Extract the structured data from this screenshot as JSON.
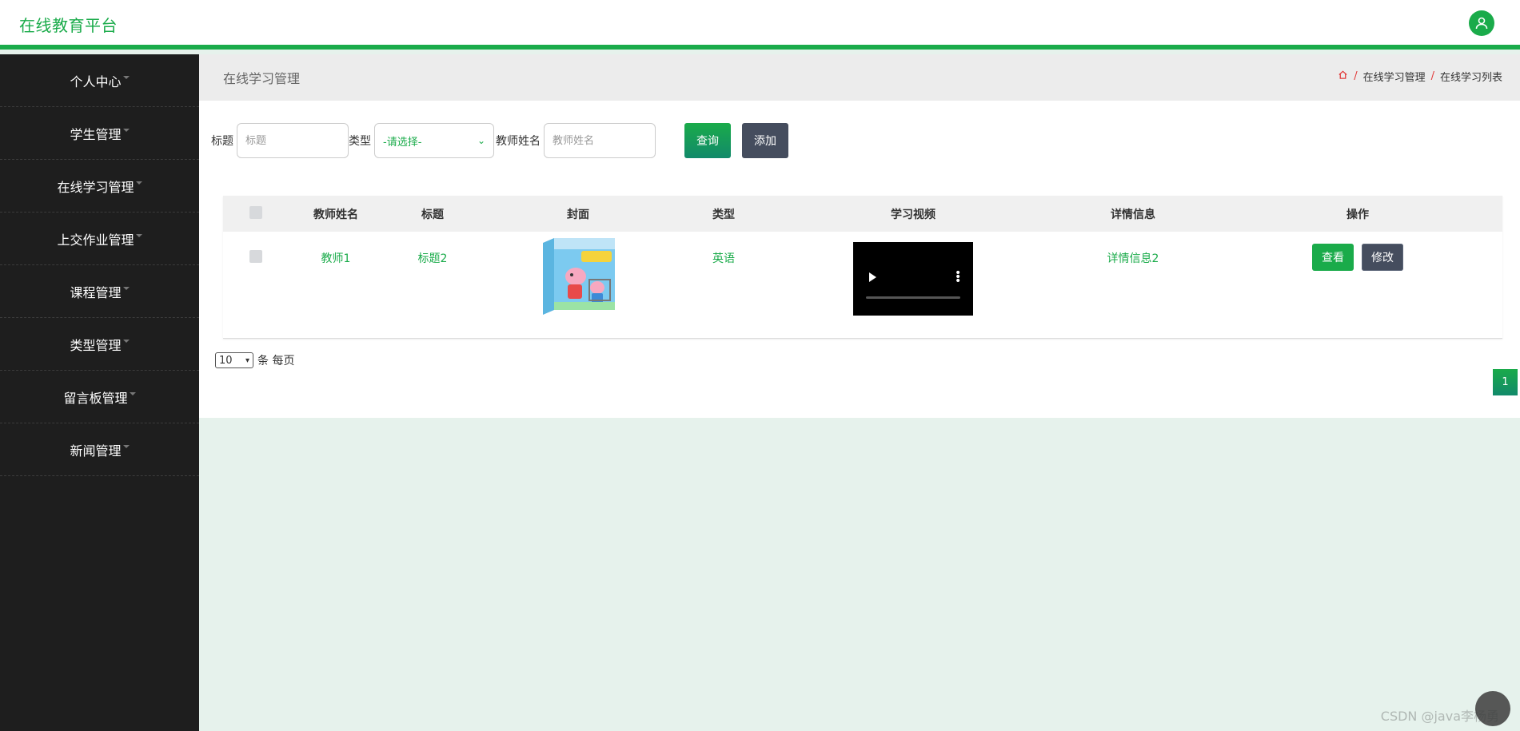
{
  "header": {
    "brand": "在线教育平台"
  },
  "sidebar": {
    "items": [
      {
        "label": "个人中心"
      },
      {
        "label": "学生管理"
      },
      {
        "label": "在线学习管理"
      },
      {
        "label": "上交作业管理"
      },
      {
        "label": "课程管理"
      },
      {
        "label": "类型管理"
      },
      {
        "label": "留言板管理"
      },
      {
        "label": "新闻管理"
      }
    ]
  },
  "crumbbar": {
    "title": "在线学习管理",
    "crumb1": "在线学习管理",
    "crumb2": "在线学习列表",
    "separator": "/"
  },
  "filters": {
    "title_label": "标题",
    "title_placeholder": "标题",
    "type_label": "类型",
    "type_selected": "-请选择-",
    "teacher_label": "教师姓名",
    "teacher_placeholder": "教师姓名",
    "query_button": "查询",
    "add_button": "添加"
  },
  "table": {
    "headers": [
      "教师姓名",
      "标题",
      "封面",
      "类型",
      "学习视频",
      "详情信息",
      "操作"
    ],
    "rows": [
      {
        "teacher": "教师1",
        "title": "标题2",
        "type": "英语",
        "detail": "详情信息2",
        "view": "查看",
        "edit": "修改"
      }
    ]
  },
  "pager": {
    "page_size": "10",
    "suffix": "条 每页",
    "current_page": "1"
  },
  "watermark": "CSDN @java李杨勇",
  "colors": {
    "accent": "#1aab4a",
    "sidebar": "#1e1e1e",
    "dark_button": "#454d5e",
    "page_bg": "#e6f2ec"
  }
}
